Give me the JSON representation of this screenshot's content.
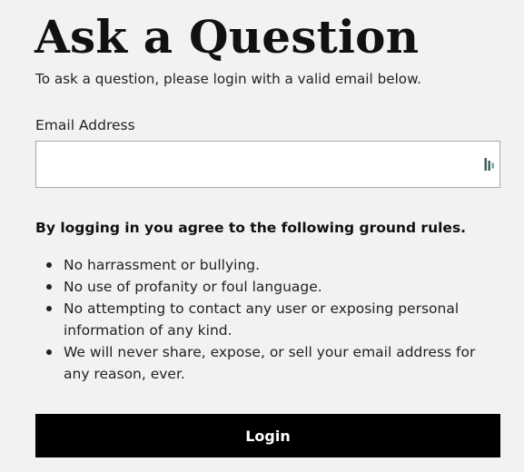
{
  "page": {
    "title": "Ask a Question",
    "intro": "To ask a question, please login with a valid email below."
  },
  "form": {
    "email_label": "Email Address",
    "email_value": "",
    "email_placeholder": "",
    "autofill_icon": "password-manager-icon",
    "login_label": "Login"
  },
  "rules": {
    "heading": "By logging in you agree to the following ground rules.",
    "items": [
      {
        "text": "No harrassment or bullying."
      },
      {
        "text": "No use of profanity or foul language."
      },
      {
        "text": "No attempting to contact any user or exposing personal information of any kind."
      },
      {
        "text": "We will never share, expose, or sell your email address for any reason, ever."
      }
    ]
  },
  "colors": {
    "background": "#f2f2f2",
    "button": "#000000",
    "button_text": "#ffffff",
    "icon": "#2f4f4f"
  }
}
